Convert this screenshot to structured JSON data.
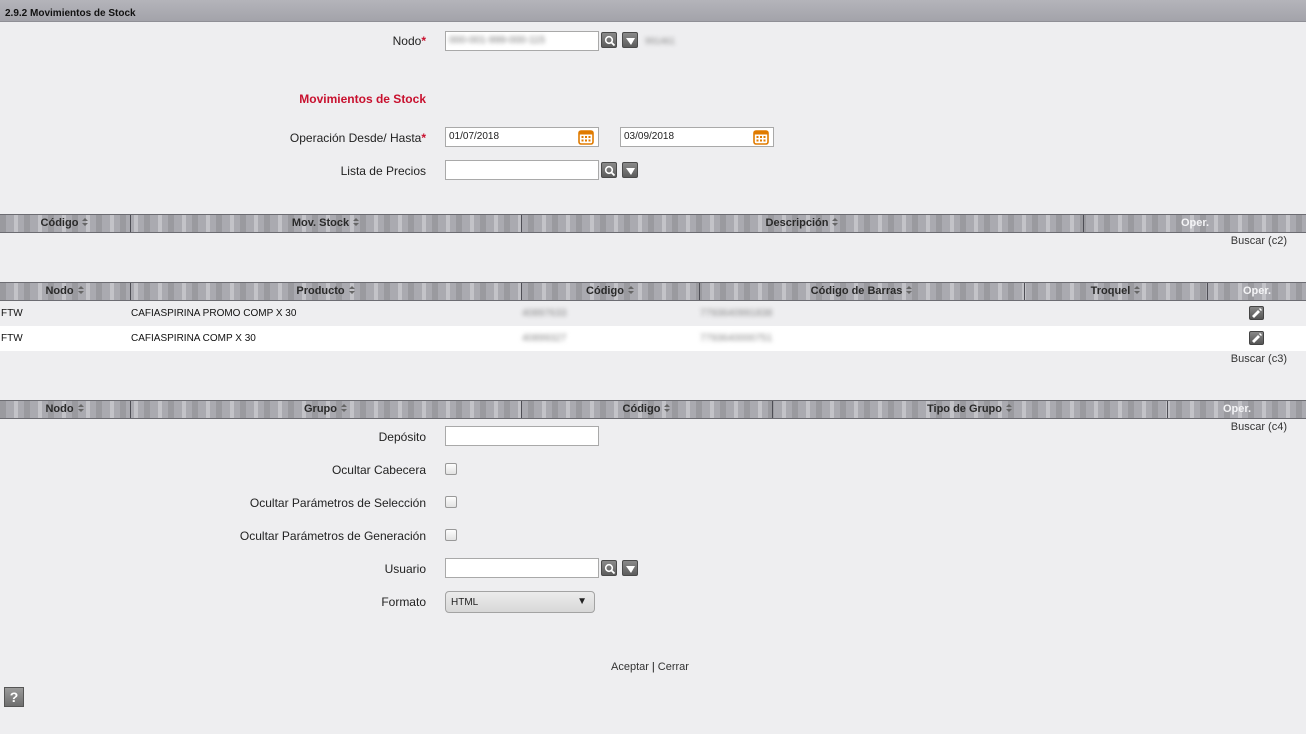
{
  "window": {
    "title": "2.9.2 Movimientos de Stock"
  },
  "form": {
    "nodo": {
      "label": "Nodo",
      "value": "000-001-999-000-115",
      "extra": "991461"
    },
    "section_title": "Movimientos de Stock",
    "operacion": {
      "label": "Operación Desde/ Hasta",
      "from": "01/07/2018",
      "to": "03/09/2018"
    },
    "lista_precios": {
      "label": "Lista de Precios",
      "value": ""
    },
    "deposito": {
      "label": "Depósito",
      "value": ""
    },
    "ocultar_cabecera": {
      "label": "Ocultar Cabecera",
      "checked": false
    },
    "ocultar_seleccion": {
      "label": "Ocultar Parámetros de Selección",
      "checked": false
    },
    "ocultar_generacion": {
      "label": "Ocultar Parámetros de Generación",
      "checked": false
    },
    "usuario": {
      "label": "Usuario",
      "value": ""
    },
    "formato": {
      "label": "Formato",
      "value": "HTML"
    },
    "required_mark": "*"
  },
  "grid_c2": {
    "columns": [
      "Código",
      "Mov. Stock",
      "Descripción",
      "Oper."
    ],
    "buscar": "Buscar (c2)"
  },
  "grid_c3": {
    "columns": [
      "Nodo",
      "Producto",
      "Código",
      "Código de Barras",
      "Troquel",
      "Oper."
    ],
    "rows": [
      {
        "nodo": "FTW",
        "producto": "CAFIASPIRINA PROMO COMP X 30",
        "codigo": "40897633",
        "barras": "7793640991838"
      },
      {
        "nodo": "FTW",
        "producto": "CAFIASPIRINA COMP X 30",
        "codigo": "40899327",
        "barras": "7793640000751"
      }
    ],
    "buscar": "Buscar (c3)"
  },
  "grid_c4": {
    "columns": [
      "Nodo",
      "Grupo",
      "Código",
      "Tipo de Grupo",
      "Oper."
    ],
    "buscar": "Buscar (c4)"
  },
  "actions": {
    "accept": "Aceptar",
    "close": "Cerrar",
    "separator": "|"
  },
  "help": {
    "label": "?"
  },
  "colors": {
    "required": "#c8102e",
    "calendar": "#e07b00"
  }
}
